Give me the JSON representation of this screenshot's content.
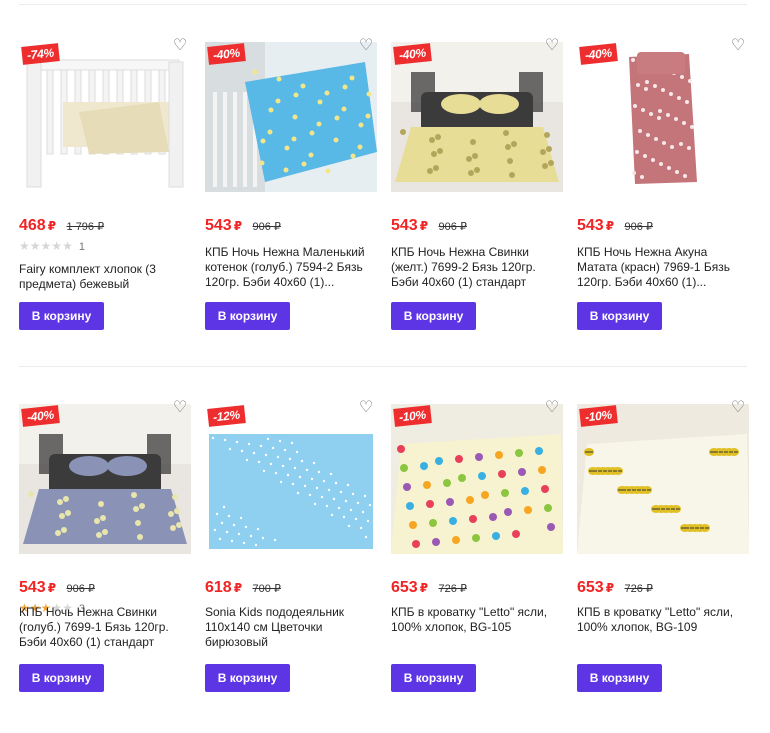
{
  "colors": {
    "price": "#f02424",
    "button": "#5e35e5",
    "discount_badge": "#ee2e2e",
    "star_active": "#f0a63a",
    "star_inactive": "#d6d6d6"
  },
  "currency": "₽",
  "products": [
    {
      "discount": "-74%",
      "price": "468",
      "old_price": "1 796 ₽",
      "rating": 0,
      "reviews": "1",
      "title": "Fairy комплект хлопок (3 предмета) бежевый",
      "button": "В корзину",
      "image": "crib-white",
      "favorite_icon": "heart-outline-icon"
    },
    {
      "discount": "-40%",
      "price": "543",
      "old_price": "906 ₽",
      "rating": null,
      "reviews": "",
      "title": "КПБ Ночь Нежна Маленький котенок (голуб.) 7594-2 Бязь 120гр. Бэби 40х60 (1)...",
      "button": "В корзину",
      "image": "crib-blue-bedding",
      "favorite_icon": "heart-outline-icon"
    },
    {
      "discount": "-40%",
      "price": "543",
      "old_price": "906 ₽",
      "rating": null,
      "reviews": "",
      "title": "КПБ Ночь Нежна Свинки (желт.) 7699-2 Бязь 120гр. Бэби 40х60 (1) стандарт",
      "button": "В корзину",
      "image": "bed-yellow-bedding",
      "favorite_icon": "heart-outline-icon"
    },
    {
      "discount": "-40%",
      "price": "543",
      "old_price": "906 ₽",
      "rating": null,
      "reviews": "",
      "title": "КПБ Ночь Нежна Акуна Матата (красн) 7969-1 Бязь 120гр. Бэби 40х60 (1)...",
      "button": "В корзину",
      "image": "red-pattern-bedding",
      "favorite_icon": "heart-outline-icon"
    },
    {
      "discount": "-40%",
      "price": "543",
      "old_price": "906 ₽",
      "rating": 3,
      "reviews": "3",
      "title": "КПБ Ночь Нежна Свинки (голуб.) 7699-1 Бязь 120гр. Бэби 40х60 (1) стандарт",
      "button": "В корзину",
      "image": "bed-grey-bedding",
      "favorite_icon": "heart-outline-icon"
    },
    {
      "discount": "-12%",
      "price": "618",
      "old_price": "700 ₽",
      "rating": null,
      "reviews": "",
      "title": "Sonia Kids пододеяльник 110х140 см Цветочки бирюзовый",
      "button": "В корзину",
      "image": "blue-duvet-cover",
      "favorite_icon": "heart-outline-icon"
    },
    {
      "discount": "-10%",
      "price": "653",
      "old_price": "726 ₽",
      "rating": null,
      "reviews": "",
      "title": "КПБ в кроватку \"Letto\" ясли, 100% хлопок, BG-105",
      "button": "В корзину",
      "image": "bed-colorful-owls",
      "favorite_icon": "heart-outline-icon"
    },
    {
      "discount": "-10%",
      "price": "653",
      "old_price": "726 ₽",
      "rating": null,
      "reviews": "",
      "title": "КПБ в кроватку \"Letto\" ясли, 100% хлопок, BG-109",
      "button": "В корзину",
      "image": "bed-bees",
      "favorite_icon": "heart-outline-icon"
    }
  ]
}
